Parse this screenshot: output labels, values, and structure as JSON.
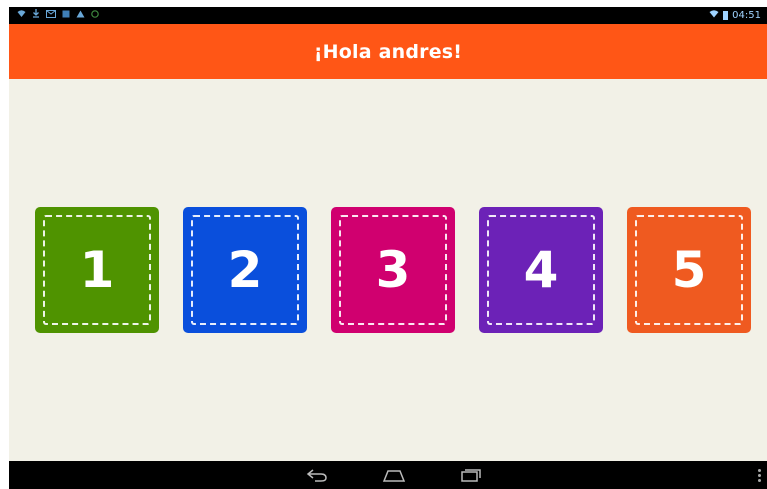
{
  "status_bar": {
    "time": "04:51",
    "notification_icons": [
      "wifi-icon",
      "download-icon",
      "mail-icon",
      "media-icon",
      "warning-icon",
      "android-icon"
    ]
  },
  "app_bar": {
    "title": "¡Hola andres!",
    "color": "#ff5616"
  },
  "tiles": [
    {
      "label": "1",
      "color": "#4f9300"
    },
    {
      "label": "2",
      "color": "#0a4fdc"
    },
    {
      "label": "3",
      "color": "#d0006f"
    },
    {
      "label": "4",
      "color": "#6c22b7"
    },
    {
      "label": "5",
      "color": "#ef5a20"
    }
  ],
  "nav_bar": {
    "buttons": [
      "back-icon",
      "home-icon",
      "recents-icon"
    ]
  }
}
